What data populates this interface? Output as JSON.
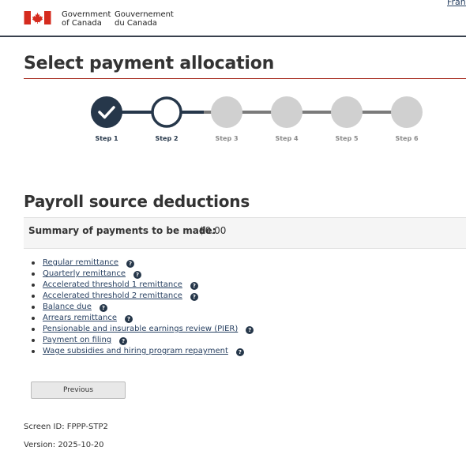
{
  "header": {
    "gov_en_line1": "Government",
    "gov_en_line2": "of Canada",
    "gov_fr_line1": "Gouvernement",
    "gov_fr_line2": "du Canada",
    "language_link": "Français"
  },
  "page_title": "Select payment allocation",
  "stepper": {
    "steps": [
      {
        "label": "Step 1",
        "state": "completed"
      },
      {
        "label": "Step 2",
        "state": "current"
      },
      {
        "label": "Step 3",
        "state": "upcoming"
      },
      {
        "label": "Step 4",
        "state": "upcoming"
      },
      {
        "label": "Step 5",
        "state": "upcoming"
      },
      {
        "label": "Step 6",
        "state": "upcoming"
      }
    ]
  },
  "section_title": "Payroll source deductions",
  "summary": {
    "label": "Summary of payments to be made:",
    "amount": "$0.00"
  },
  "payment_types": [
    {
      "label": "Regular remittance"
    },
    {
      "label": "Quarterly remittance"
    },
    {
      "label": "Accelerated threshold 1 remittance"
    },
    {
      "label": "Accelerated threshold 2 remittance"
    },
    {
      "label": "Balance due"
    },
    {
      "label": "Arrears remittance"
    },
    {
      "label": "Pensionable and insurable earnings review (PIER)"
    },
    {
      "label": "Payment on filing"
    },
    {
      "label": "Wage subsidies and hiring program repayment"
    }
  ],
  "help_glyph": "?",
  "buttons": {
    "previous": "Previous"
  },
  "footer": {
    "screen_id": "Screen ID: FPPP-STP2",
    "version": "Version: 2025-10-20"
  },
  "colors": {
    "primary": "#26374a",
    "link": "#284162",
    "accent_rule": "#a62a1e",
    "flag_red": "#d52b1e",
    "inactive": "#d0d0d0"
  }
}
